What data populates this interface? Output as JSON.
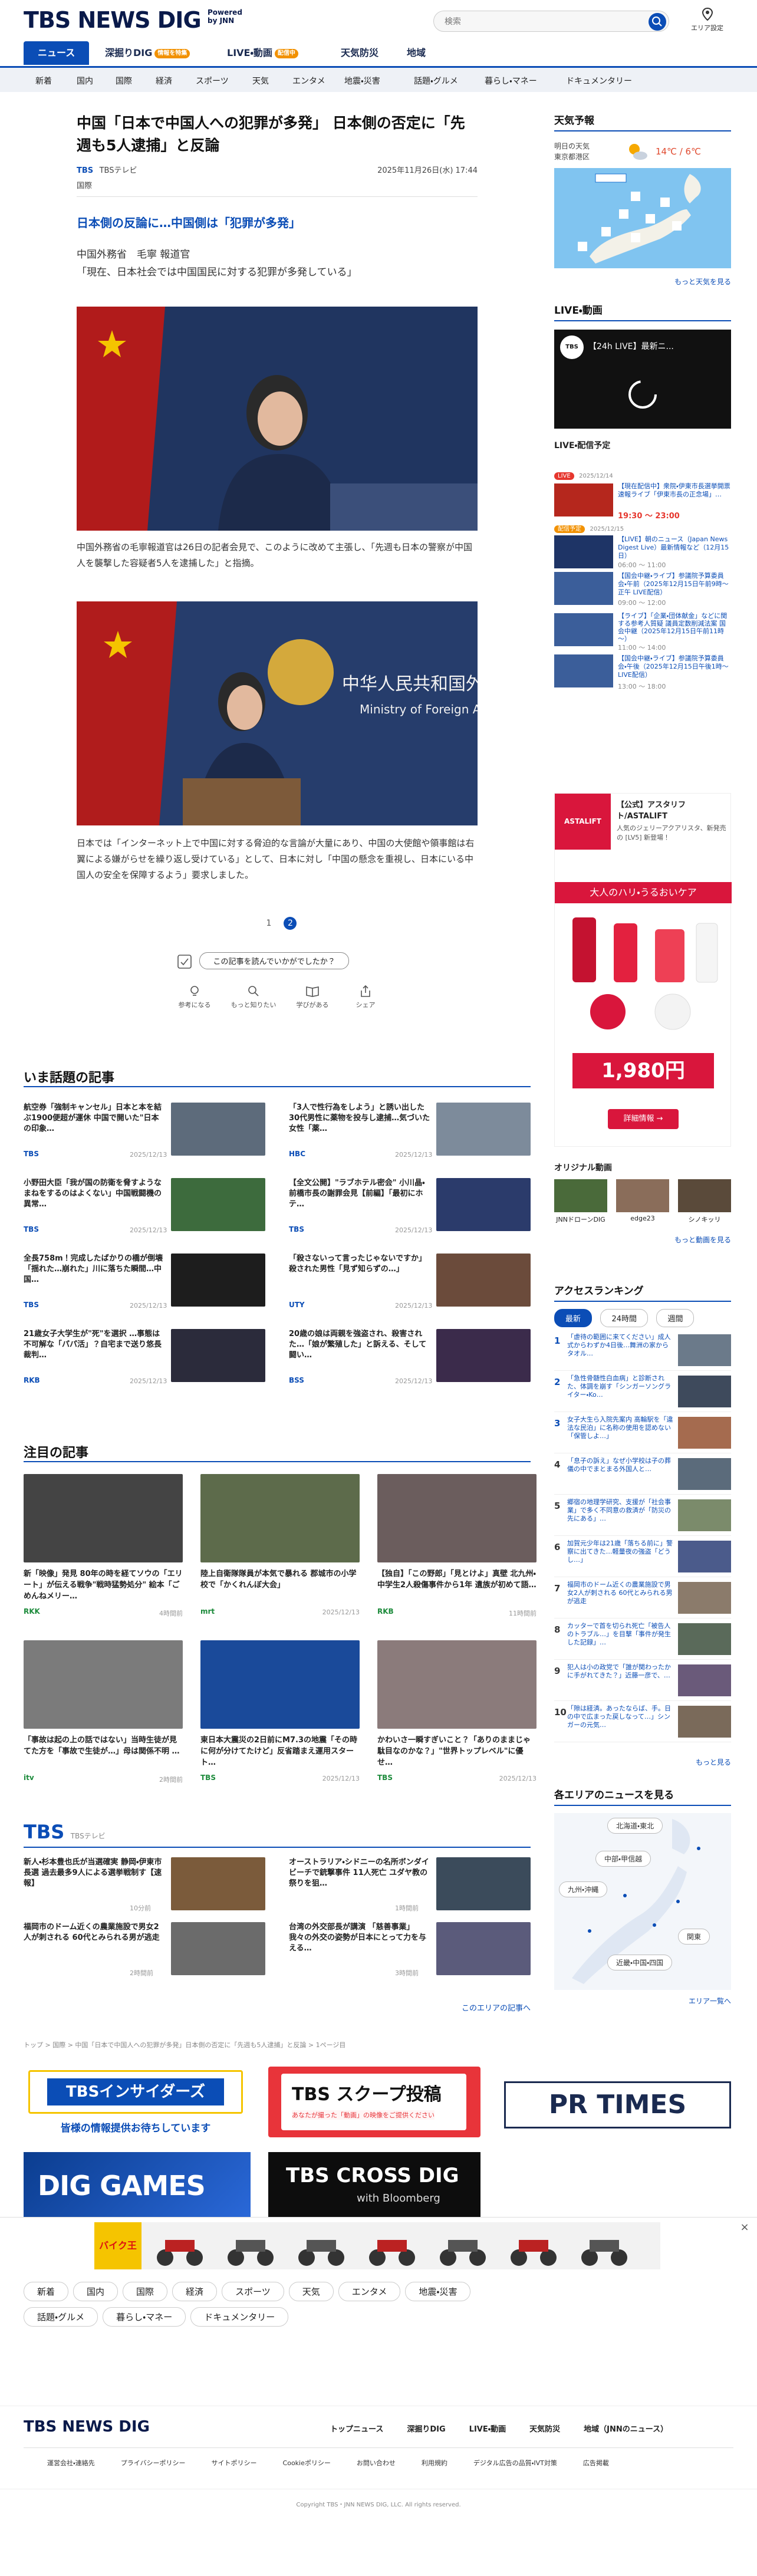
{
  "header": {
    "logo": "TBS NEWS DIG",
    "logo_sub_1": "Powered",
    "logo_sub_2": "by JNN",
    "search_placeholder": "検索",
    "area_label": "エリア設定"
  },
  "main_nav": [
    {
      "label": "ニュース"
    },
    {
      "label": "深掘りDIG",
      "badge": "情報を特集"
    },
    {
      "label": "LIVE・動画",
      "badge": "配信中"
    },
    {
      "label": "天気防災"
    },
    {
      "label": "地域"
    }
  ],
  "sub_nav": [
    "新着",
    "国内",
    "国際",
    "経済",
    "スポーツ",
    "天気",
    "エンタメ",
    "地震・災害",
    "話題・グルメ",
    "暮らし・マネー",
    "ドキュメンタリー"
  ],
  "article": {
    "title": "中国「日本で中国人への犯罪が多発」 日本側の否定に「先週も5人逮捕」と反論",
    "source": "TBSテレビ",
    "date": "2025年11月26日(水) 17:44",
    "category": "国際",
    "lead": "日本側の反論に…中国側は「犯罪が多発」",
    "speaker": "中国外務省　毛寧 報道官",
    "quote": "「現在、日本社会では中国国民に対する犯罪が多発している」",
    "caption1": "中国外務省の毛寧報道官は26日の記者会見で、このように改めて主張し、「先週も日本の警察が中国人を襲撃した容疑者5人を逮捕した」と指摘。",
    "caption2": "日本では「インターネット上で中国に対する脅迫的な言論が大量にあり、中国の大使館や領事館は右翼による嫌がらせを繰り返し受けている」として、日本に対し「中国の懸念を重視し、日本にいる中国人の安全を保障するよう」要求しました。",
    "pages": [
      "1",
      "2"
    ],
    "feedback_q": "この記事を読んでいかがでしたか？",
    "feedback": [
      "参考になる",
      "もっと知りたい",
      "学びがある",
      "シェア"
    ]
  },
  "right": {
    "weather_h": "天気予報",
    "weather_day": "明日の天気",
    "weather_area": "東京都港区",
    "weather_temp": "14℃ / 6℃",
    "weather_more": "もっと天気を見る",
    "live_h": "LIVE・動画",
    "live_title": "【24h LIVE】最新ニ...",
    "sched_h": "LIVE・配信予定",
    "sched": [
      {
        "date": "2025/12/14",
        "title": "【現在配信中】衆院・伊東市長選挙開票速報ライブ「伊東市長の正念場」…",
        "time": "19:30 ～ 23:00",
        "live": true
      },
      {
        "date": "2025/12/15",
        "title": "【LIVE】朝のニュース（Japan News Digest Live）最新情報など（12月15日）",
        "time": "06:00 ～ 11:00",
        "live": false
      },
      {
        "date": "",
        "title": "【国会中継・ライブ】参議院予算委員会・午前（2025年12月15日午前9時～正午 LIVE配信）",
        "time": "09:00 ～ 12:00",
        "live": false
      },
      {
        "date": "",
        "title": "【ライブ】「企業・団体献金」などに関する参考人質疑 議員定数削減法案 国会中継（2025年12月15日午前11時～）",
        "time": "11:00 ～ 14:00",
        "live": false
      },
      {
        "date": "",
        "title": "【国会中継・ライブ】参議院予算委員会・午後（2025年12月15日午後1時～ LIVE配信）",
        "time": "13:00 ～ 18:00",
        "live": false
      }
    ],
    "ad_brand": "【公式】アスタリフト/ASTALIFT",
    "ad_desc": "人気のジェリーアクアリスタ、新発売の [LV5] 新登場！",
    "ad_banner": "大人のハリ・うるおいケア",
    "ad_price": "1,980円",
    "ad_btn": "詳細情報 →",
    "orig_h": "オリジナル動画",
    "orig_items": [
      "JNNドローンDIG",
      "edge23",
      "シノキッリ"
    ],
    "orig_more": "もっと動画を見る",
    "rank_h": "アクセスランキング",
    "rank_tabs": [
      "最新",
      "24時間",
      "週間"
    ],
    "ranking": [
      "「虐待の範囲に来てください」成人式からわずか4日後…舞洲の家からタオル…",
      "「急性骨髄性白血病」と診断された、体調を崩す「シンガーソングライター・Ko…",
      "女子大生ら入院先案内 高輪駅を「違法な民泊」に名称の使用を認めない「保管しよ…」",
      "「息子の訴え」なぜ小学校は子の葬儀の中でまとまる外国人と…",
      "郷宿の地理学研究、支援が「社会事業」で多く不同意の救済が「防災の先にある」…",
      "加賀元少年は21歳「落ちる前に」警察に出てきた…軽量夜の強盗「どうし…」",
      "福岡市のドーム近くの農業施設で男女2人が刺される 60代とみられる男が逃走",
      "カッターで首を切られ死亡「被告人のトラブル…」を目撃「事件が発生した記録」…",
      "犯人は小の政党で「誰が関わったかに手がれてきた？」近藤一彦で、…",
      "「隙は経済。あったならば、手。日の中で広まった戻しなって…」シンガーの元気…"
    ],
    "rank_more": "もっと見る",
    "area_h": "各エリアのニュースを見る",
    "areas": [
      "北海道・東北",
      "中部・甲信越",
      "九州・沖縄",
      "関東",
      "近畿・中国・四国"
    ],
    "area_more": "エリア一覧へ"
  },
  "trending_h": "いま話題の記事",
  "trending": [
    {
      "title": "航空券「強制キャンセル」日本と本を結ぶ1900便超が運休 中国で開いた\"日本の印象…",
      "src": "TBS",
      "date": "2025/12/13"
    },
    {
      "title": "「3人で性行為をしよう」と誘い出した30代男性に薬物を投与し逮捕…気づいた女性「薬…",
      "src": "HBC",
      "date": "2025/12/13"
    },
    {
      "title": "小野田大臣「我が国の防衛を脅すようなまねをするのはよくない」中国戦闘機の異常…",
      "src": "TBS",
      "date": "2025/12/13"
    },
    {
      "title": "【全文公開】\"ラブホテル密会\" 小川晶・前橋市長の謝罪会見【前編】「最初にホテ…",
      "src": "TBS",
      "date": "2025/12/13"
    },
    {
      "title": "全長758m！完成したばかりの橋が倒壊「揺れた…崩れた」川に落ちた瞬間…中国…",
      "src": "TBS",
      "date": "2025/12/13"
    },
    {
      "title": "「殺さないって言ったじゃないですか」殺された男性「見ず知らずの…」",
      "src": "UTY",
      "date": "2025/12/13"
    },
    {
      "title": "21歳女子大学生が\"死\"を選択 …事態は不可解な「パパ活」？自宅まで送り悠長 裁判…",
      "src": "RKB",
      "date": "2025/12/13"
    },
    {
      "title": "20歳の娘は両親を強盗され、殺害された…「娘が繁殖した」と訴える、そして闘い…",
      "src": "BSS",
      "date": "2025/12/13"
    }
  ],
  "featured_h": "注目の記事",
  "featured": [
    {
      "title": "新「映像」発見 80年の時を経てソウの「エリート」が伝える戦争\"戦時猛勢処分\" 絵本「ごめんねメリー…",
      "src": "RKK",
      "date": "4時間前"
    },
    {
      "title": "陸上自衛隊隊員が本気で暴れる 郡城市の小学校で「かくれんぼ大会」",
      "src": "mrt",
      "date": "2025/12/13"
    },
    {
      "title": "【独自】「この野郎」「見とけよ」真壁 北九州・中学生2人殺傷事件から1年 遺族が初めて語…",
      "src": "RKB",
      "date": "11時間前"
    },
    {
      "title": "「事故は起の上の話ではない」当時生徒が見てた方を「事故で生徒が…」母は関係不明 …",
      "src": "itv",
      "date": "2時間前"
    },
    {
      "title": "東日本大震災の2日前にM7.3の地震「その時に何が分けてたけど」反省踏まえ運用スタート…",
      "src": "TBS",
      "date": "2025/12/13"
    },
    {
      "title": "かわいさ一瞬すぎいこと？「ありのままじゃ駄目なのかな？」\"世界トップレベル\"に優せ…",
      "src": "TBS",
      "date": "2025/12/13"
    }
  ],
  "tbs_h": "TBS",
  "tbs_sub": "TBSテレビ",
  "tbs_items": [
    {
      "title": "新人・杉本豊也氏が当選確実 静岡・伊東市長選 過去最多9人による選挙戦制す【速報】",
      "date": "10分前"
    },
    {
      "title": "オーストラリア・シドニーの名所ボンダイビーチで銃撃事件 11人死亡 ユダヤ教の祭りを狙…",
      "date": "1時間前"
    },
    {
      "title": "福岡市のドーム近くの農業施設で男女2人が刺される 60代とみられる男が逃走",
      "date": "2時間前"
    },
    {
      "title": "台湾の外交部長が講演 「慈善事業」 我々の外交の姿勢が日本にとって力を与える…",
      "date": "3時間前"
    }
  ],
  "tbs_more": "このエリアの記事へ",
  "breadcrumb": "トップ > 国際 > 中国「日本で中国人への犯罪が多発」日本側の否定に「先週も5人逮捕」と反論 > 1ページ目",
  "banners": {
    "insider": "TBSインサイダーズ",
    "insider_sub": "皆様の情報提供お待ちしています",
    "scoop": "TBS スクープ投稿",
    "scoop_sub": "あなたが撮った「動画」の映像をご提供ください",
    "prtimes": "PR TIMES",
    "games": "DIG GAMES",
    "crossdig": "TBS CROSS DIG",
    "crossdig_sub": "with Bloomberg"
  },
  "bike_ad": "バイク王",
  "bottom_chips": [
    "新着",
    "国内",
    "国際",
    "経済",
    "スポーツ",
    "天気",
    "エンタメ",
    "地震・災害",
    "話題・グルメ",
    "暮らし・マネー",
    "ドキュメンタリー"
  ],
  "footer": {
    "logo": "TBS NEWS DIG",
    "links1": [
      "トップニュース",
      "深掘りDIG",
      "LIVE・動画",
      "天気防災",
      "地域（JNNのニュース）"
    ],
    "links2": [
      "運営会社・連絡先",
      "プライバシーポリシー",
      "サイトポリシー",
      "Cookieポリシー",
      "お問い合わせ",
      "利用規約",
      "デジタル広告の品質・IVT対策",
      "広告掲載"
    ],
    "copyright": "Copyright TBS・JNN NEWS DIG, LLC. All rights reserved."
  },
  "colors": {
    "brand": "#0b4db6",
    "accent": "#f29100",
    "live": "#e6372e"
  }
}
